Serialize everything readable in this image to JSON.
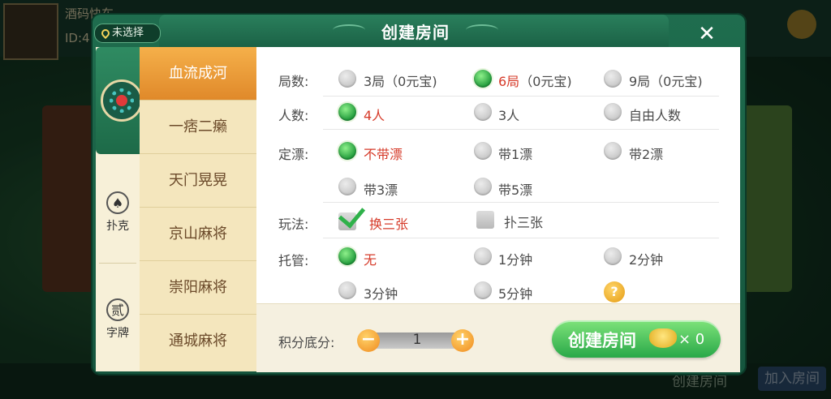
{
  "background": {
    "player_name": "酒码快车",
    "player_id": "ID:4",
    "create_room_label": "创建房间",
    "join_room_label": "加入房间"
  },
  "location": {
    "label": "未选择"
  },
  "dialog": {
    "title": "创建房间",
    "close_icon": "close-icon"
  },
  "categories": [
    {
      "label": "扑克",
      "icon": "spade-icon",
      "glyph": "♠"
    },
    {
      "label": "字牌",
      "icon": "character-tile-icon",
      "glyph": "贰"
    }
  ],
  "games": [
    "血流成河",
    "一痞二癞",
    "天门晃晃",
    "京山麻将",
    "崇阳麻将",
    "通城麻将"
  ],
  "selected_game": "血流成河",
  "options": {
    "rounds": {
      "label": "局数:",
      "choices": [
        "3局（0元宝)",
        "6局（0元宝)",
        "9局（0元宝)"
      ],
      "selected": 1
    },
    "players": {
      "label": "人数:",
      "choices": [
        "4人",
        "3人",
        "自由人数"
      ],
      "selected": 0
    },
    "piao": {
      "label": "定漂:",
      "choices": [
        "不带漂",
        "带1漂",
        "带2漂",
        "带3漂",
        "带5漂"
      ],
      "selected": 0
    },
    "play": {
      "label": "玩法:",
      "choices": [
        {
          "text": "换三张",
          "checked": true
        },
        {
          "text": "扑三张",
          "checked": false
        }
      ]
    },
    "auto": {
      "label": "托管:",
      "choices": [
        "无",
        "1分钟",
        "2分钟",
        "3分钟",
        "5分钟"
      ],
      "selected": 0,
      "help": "?"
    }
  },
  "score": {
    "label": "积分底分:",
    "value": "1",
    "minus": "−",
    "plus": "+"
  },
  "create_button": {
    "label": "创建房间",
    "cost": "× 0"
  },
  "colors": {
    "accent_green": "#29a848",
    "selected_text": "#d63b2a",
    "tab_orange": "#e0892a"
  }
}
